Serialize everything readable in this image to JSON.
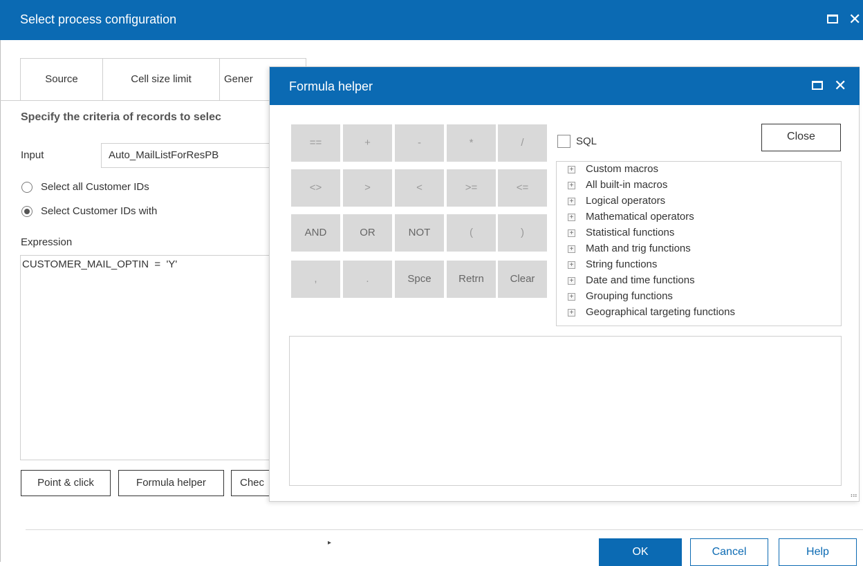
{
  "main_dialog": {
    "title": "Select process configuration",
    "tabs": [
      "Source",
      "Cell size limit",
      "Gener"
    ],
    "heading": "Specify the criteria of records to selec",
    "input_label": "Input",
    "input_value": "Auto_MailListForResPB",
    "radio_all": "Select all Customer IDs",
    "radio_with": "Select Customer IDs with",
    "radio_selected": "with",
    "expression_label": "Expression",
    "expression_value": "CUSTOMER_MAIL_OPTIN  =  'Y'",
    "buttons": {
      "point_click": "Point & click",
      "formula_helper": "Formula helper",
      "check": "Chec"
    },
    "footer": {
      "ok": "OK",
      "cancel": "Cancel",
      "help": "Help"
    }
  },
  "formula_helper": {
    "title": "Formula helper",
    "operators": [
      [
        "==",
        "+",
        "-",
        "*",
        "/"
      ],
      [
        "<>",
        ">",
        "<",
        ">=",
        "<="
      ],
      [
        "AND",
        "OR",
        "NOT",
        "(",
        ")"
      ],
      [
        ",",
        ".",
        "Spce",
        "Retrn",
        "Clear"
      ]
    ],
    "sql_label": "SQL",
    "sql_checked": false,
    "close_label": "Close",
    "tree_items": [
      "Custom macros",
      "All built-in macros",
      "Logical operators",
      "Mathematical operators",
      "Statistical functions",
      "Math and trig functions",
      "String functions",
      "Date and time functions",
      "Grouping functions",
      "Geographical targeting functions"
    ],
    "formula_text": ""
  },
  "icons": {
    "maximize": "maximize-icon",
    "close": "close-icon",
    "expand": "plus-box-icon",
    "resize": "resize-grip-icon"
  },
  "colors": {
    "titlebar": "#0b6ab3",
    "button_gray": "#d9d9d9"
  }
}
